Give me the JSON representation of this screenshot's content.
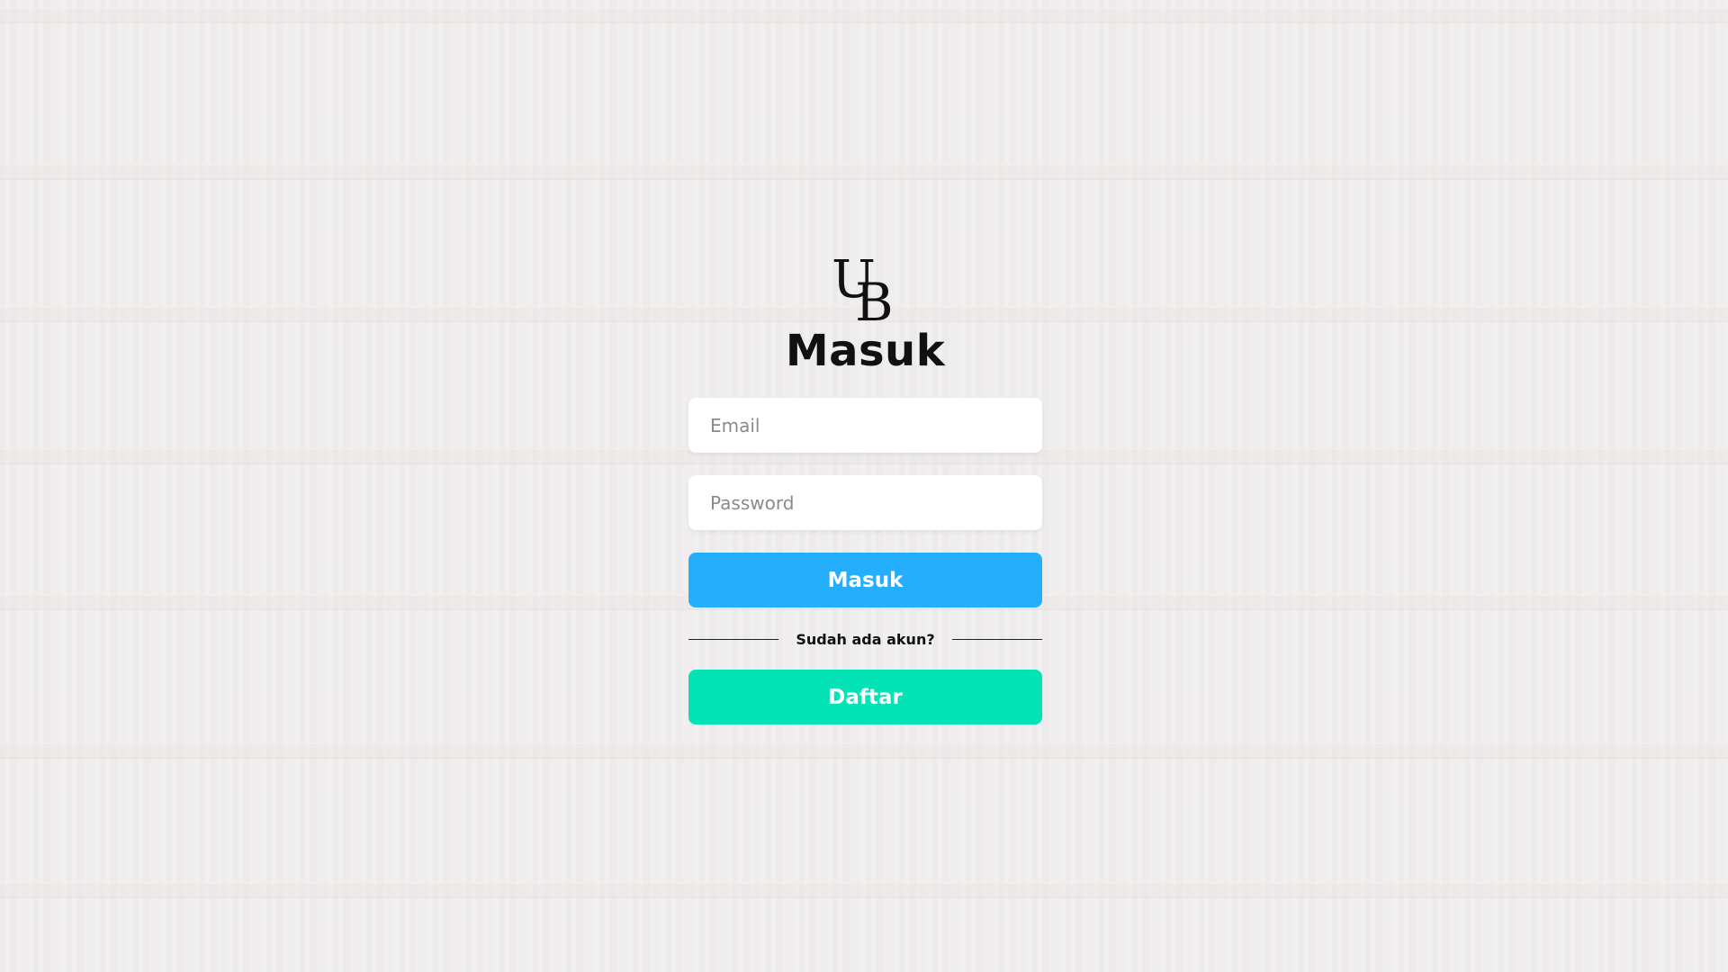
{
  "brand": {
    "logo_text": "UB",
    "logo_icon": "ub-monogram-icon"
  },
  "form": {
    "title": "Masuk",
    "email_placeholder": "Email",
    "password_placeholder": "Password",
    "login_button": "Masuk",
    "divider_text": "Sudah ada akun?",
    "register_button": "Daftar"
  },
  "colors": {
    "login_button": "#24aefc",
    "register_button": "#04e3b6",
    "title": "#111111"
  }
}
